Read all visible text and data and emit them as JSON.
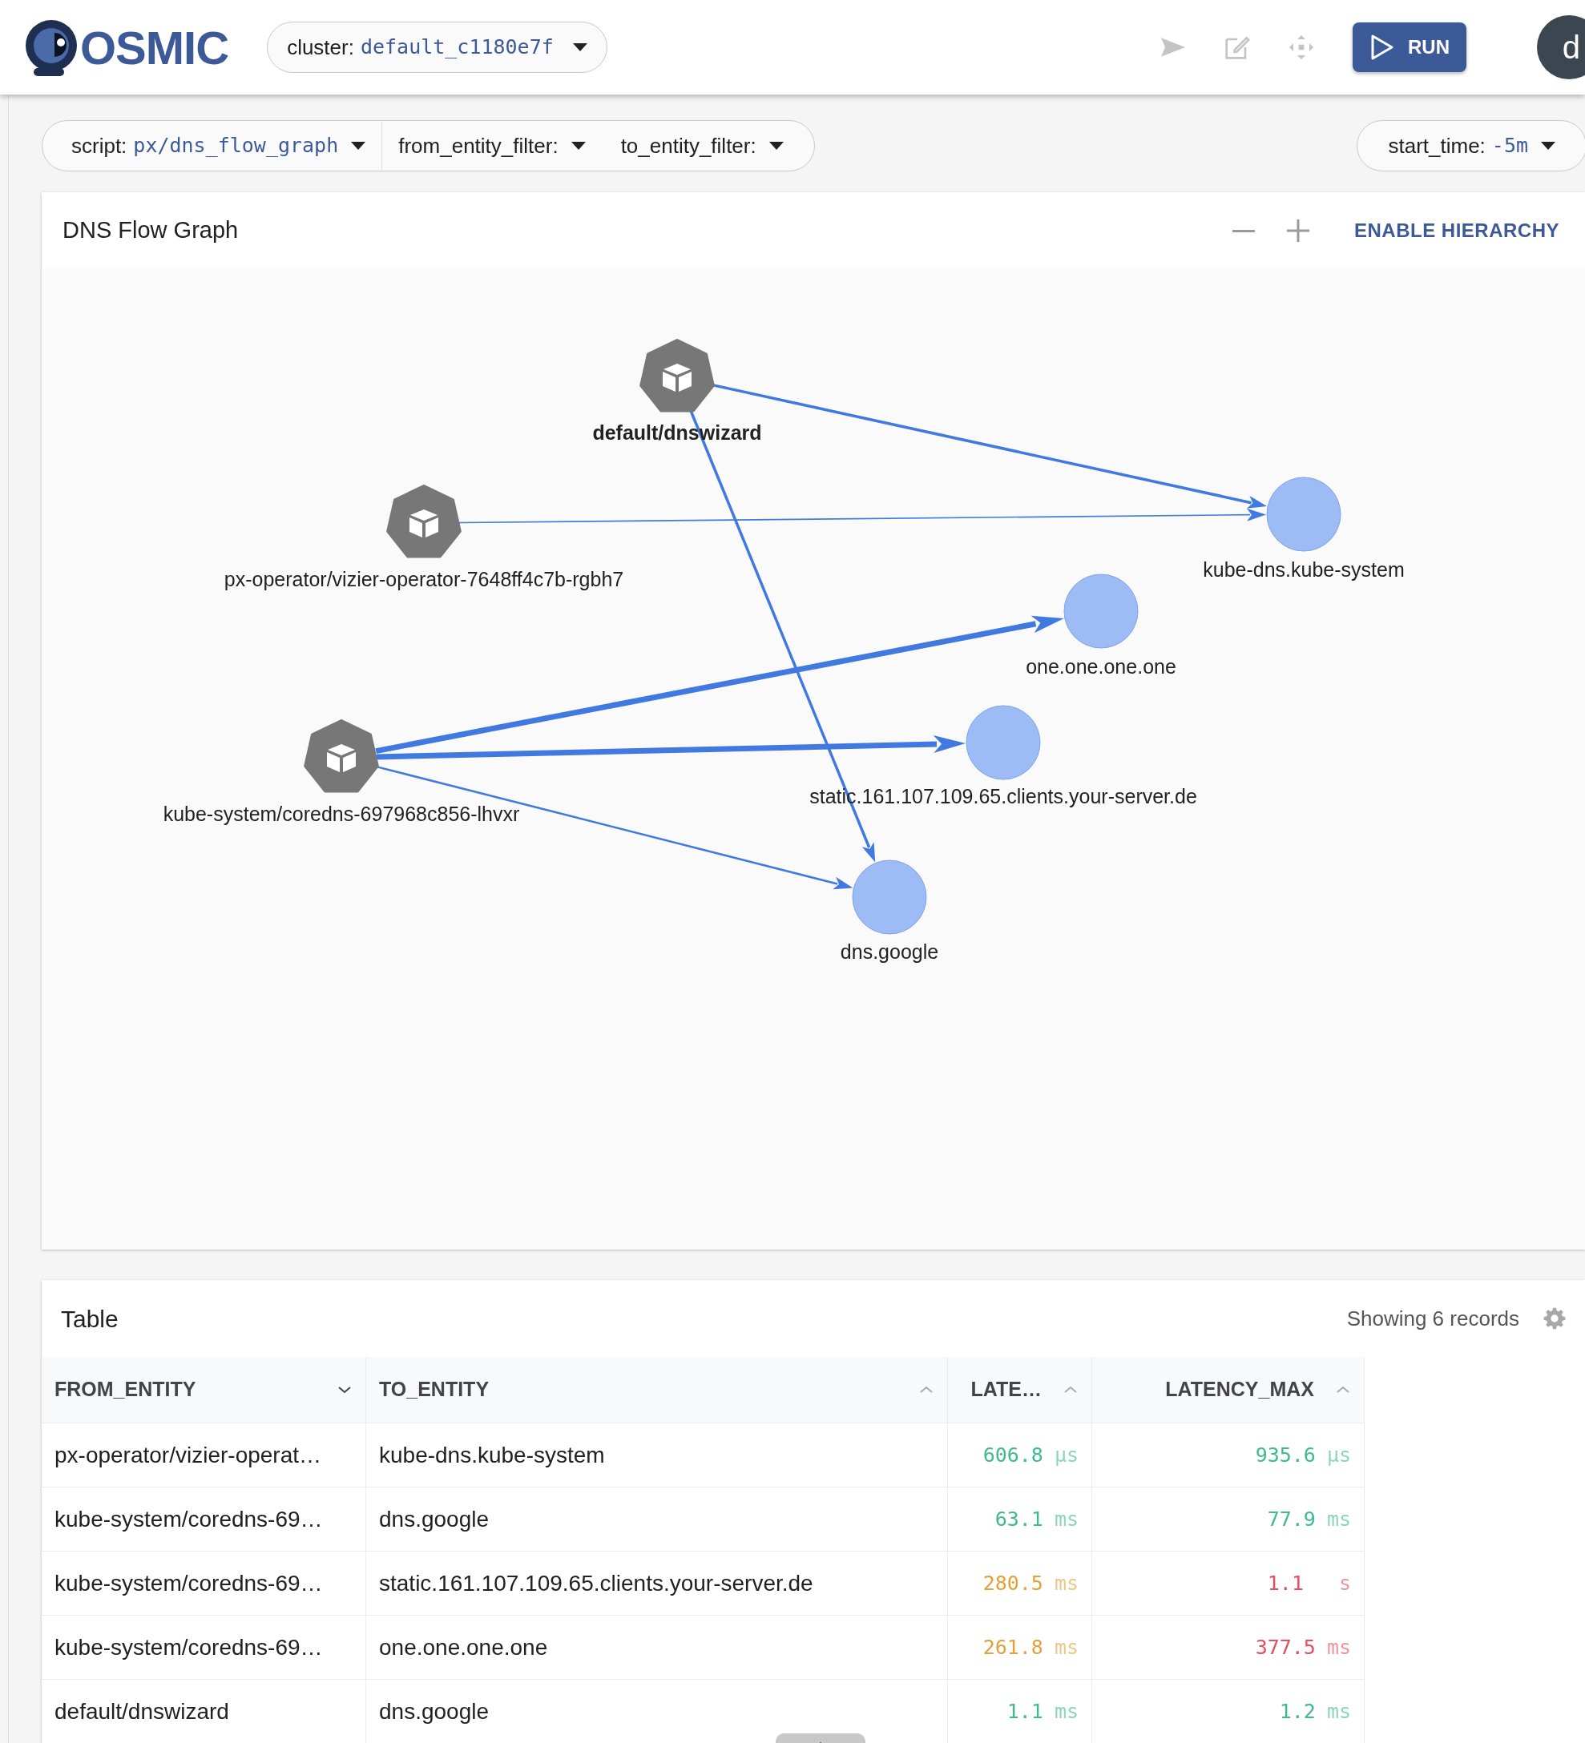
{
  "topbar": {
    "logo_text": "OSMIC",
    "cluster": {
      "label": "cluster:",
      "value": "default_c1180e7f"
    },
    "run_button": "RUN",
    "avatar_letter": "d"
  },
  "filters": {
    "left": [
      {
        "label": "script:",
        "value": "px/dns_flow_graph"
      },
      {
        "label": "from_entity_filter:"
      },
      {
        "label": "to_entity_filter:"
      }
    ],
    "right": [
      {
        "label": "start_time:",
        "value": "-5m"
      }
    ]
  },
  "graph": {
    "title": "DNS Flow Graph",
    "hierarchy_button": "ENABLE HIERARCHY",
    "nodes": [
      {
        "kind": "pod",
        "label": "default/dnswizard",
        "selected": true
      },
      {
        "kind": "pod",
        "label": "px-operator/vizier-operator-7648ff4c7b-rgbh7",
        "selected": false
      },
      {
        "kind": "pod",
        "label": "kube-system/coredns-697968c856-lhvxr",
        "selected": false
      },
      {
        "kind": "service",
        "label": "kube-dns.kube-system",
        "selected": false
      },
      {
        "kind": "service",
        "label": "one.one.one.one",
        "selected": false
      },
      {
        "kind": "service",
        "label": "static.161.107.109.65.clients.your-server.de",
        "selected": false
      },
      {
        "kind": "service",
        "label": "dns.google",
        "selected": false
      }
    ]
  },
  "table": {
    "title": "Table",
    "record_count": "Showing 6 records",
    "columns": [
      {
        "label": "FROM_ENTITY",
        "sorted_descending": true
      },
      {
        "label": "TO_ENTITY",
        "sorted_descending": false
      },
      {
        "label": "LATE…",
        "sorted_descending": false
      },
      {
        "label": "LATENCY_MAX",
        "sorted_descending": false
      }
    ],
    "rows": [
      {
        "from": "px-operator/vizier-operat…",
        "to": "kube-dns.kube-system",
        "latency": [
          {
            "value": "606.8",
            "unit": "µs",
            "color": "#3fba8f"
          },
          {
            "value": "935.6",
            "unit": "µs",
            "color": "#3fba8f"
          }
        ]
      },
      {
        "from": "kube-system/coredns-69…",
        "to": "dns.google",
        "latency": [
          {
            "value": "63.1",
            "unit": "ms",
            "color": "#3fba8f"
          },
          {
            "value": "77.9",
            "unit": "ms",
            "color": "#3fba8f"
          }
        ]
      },
      {
        "from": "kube-system/coredns-69…",
        "to": "static.161.107.109.65.clients.your-server.de",
        "latency": [
          {
            "value": "280.5",
            "unit": "ms",
            "color": "#e4a13a"
          },
          {
            "value": "1.1",
            "unit": "s",
            "color": "#e84d5f"
          }
        ]
      },
      {
        "from": "kube-system/coredns-69…",
        "to": "one.one.one.one",
        "latency": [
          {
            "value": "261.8",
            "unit": "ms",
            "color": "#e4a13a"
          },
          {
            "value": "377.5",
            "unit": "ms",
            "color": "#e84d5f"
          }
        ]
      },
      {
        "from": "default/dnswizard",
        "to": "dns.google",
        "latency": [
          {
            "value": "1.1",
            "unit": "ms",
            "color": "#3fba8f"
          },
          {
            "value": "1.2",
            "unit": "ms",
            "color": "#3fba8f"
          }
        ]
      }
    ]
  }
}
